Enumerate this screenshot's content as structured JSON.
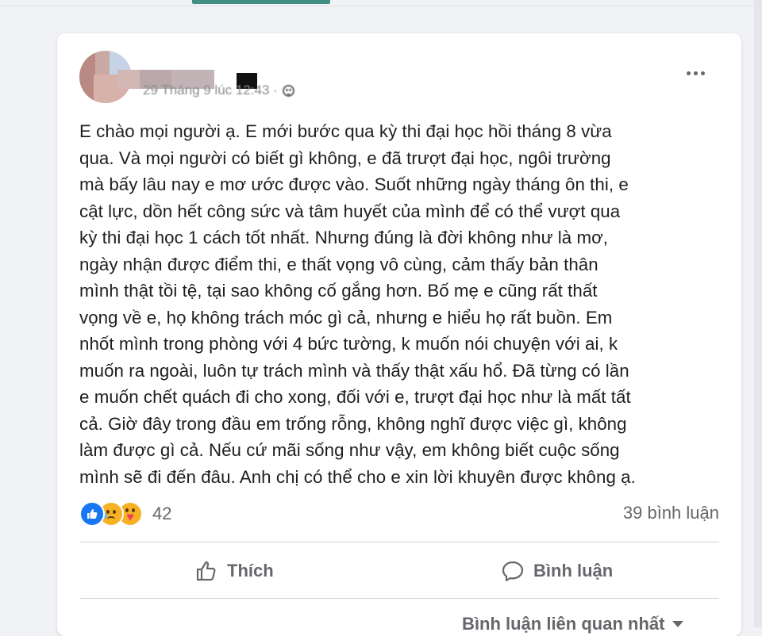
{
  "post": {
    "timestamp": "29 Tháng 9 lúc 12:43 ·",
    "privacy_icon": "globe-icon",
    "text": "E chào mọi người ạ. E mới bước qua kỳ thi đại học hồi tháng 8 vừa\nqua. Và mọi người có biết gì không, e đã trượt đại học, ngôi trường\nmà bấy lâu nay e mơ ước được vào. Suốt những ngày tháng ôn thi, e\ncật lực, dồn hết công sức và tâm huyết của mình để có thể vượt qua\nkỳ thi đại học 1 cách tốt nhất. Nhưng đúng là đời không như là mơ,\nngày nhận được điểm thi, e thất vọng vô cùng, cảm thấy bản thân\nmình thật tồi tệ, tại sao không cố gắng hơn. Bố mẹ e cũng rất thất\nvọng về e, họ không trách móc gì cả, nhưng e hiểu họ rất buồn. Em\nnhốt mình trong phòng với 4 bức tường, k muốn nói chuyện với ai, k\nmuốn ra ngoài, luôn tự trách mình và thấy thật xấu hổ. Đã từng có lần\ne muốn chết quách đi cho xong, đối với e, trượt đại học như là mất tất\ncả. Giờ đây trong đầu em trống rỗng, không nghĩ được việc gì, không\nlàm được gì cả. Nếu cứ mãi sống như vậy, em không biết cuộc sống\nmình sẽ đi đến đâu. Anh chị có thể cho e xin lời khuyên được không ạ."
  },
  "reactions": {
    "types": [
      "like",
      "sad",
      "care"
    ],
    "count": "42"
  },
  "comments_count": "39 bình luận",
  "actions": {
    "like_label": "Thích",
    "comment_label": "Bình luận"
  },
  "sort": {
    "label": "Bình luận liên quan nhất"
  },
  "colors": {
    "accent": "#1877f2",
    "tab_indicator": "#3f8f82",
    "secondary_text": "#65676b"
  }
}
